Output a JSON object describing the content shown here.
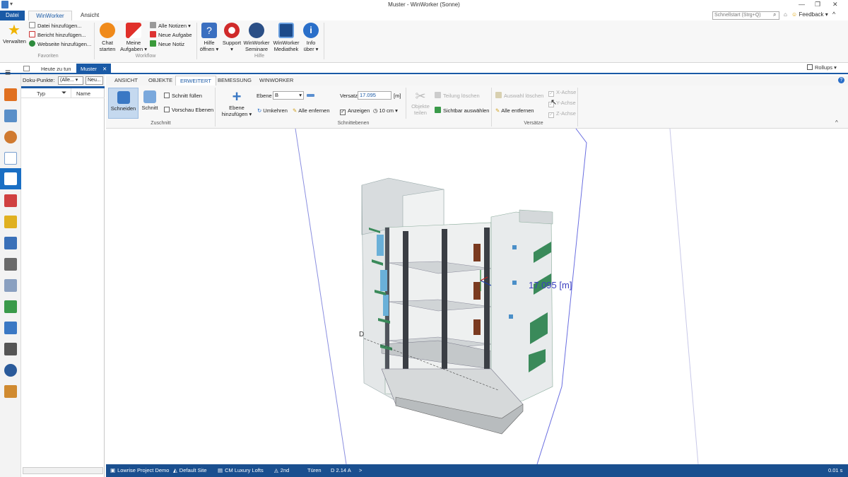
{
  "window": {
    "title": "Muster - WinWorker (Sonne)",
    "search_placeholder": "Schnellstart (Strg+Q)",
    "feedback": "Feedback",
    "minimize": "—",
    "restore": "❐",
    "close": "✕"
  },
  "ribbon_tabs": [
    "Datei",
    "WinWorker",
    "Ansicht"
  ],
  "ribbon": {
    "favoriten": {
      "verwalten": "Verwalten",
      "datei_hinzufuegen": "Datei hinzufügen...",
      "bericht_hinzufuegen": "Bericht hinzufügen...",
      "webseite_hinzufuegen": "Webseite hinzufügen...",
      "label": "Favoriten"
    },
    "workflow": {
      "chat_1": "Chat",
      "chat_2": "starten",
      "aufgaben_1": "Meine",
      "aufgaben_2": "Aufgaben",
      "alle_notizen": "Alle Notizen",
      "neue_aufgabe": "Neue Aufgabe",
      "neue_notiz": "Neue Notiz",
      "label": "Workflow"
    },
    "hilfe": {
      "hilfe_1": "Hilfe",
      "hilfe_2": "öffnen",
      "support": "Support",
      "seminare_1": "WinWorker",
      "seminare_2": "Seminare",
      "mediathek_1": "WinWorker",
      "mediathek_2": "Mediathek",
      "info_1": "Info",
      "info_2": "über",
      "label": "Hilfe"
    }
  },
  "doc_tabs": [
    "Heute zu tun",
    "Muster"
  ],
  "rollups": "Rollups",
  "doku": {
    "label": "Doku-Punkte:",
    "filter": "(Alle...",
    "new": "Neu...",
    "col_typ": "Typ",
    "col_name": "Name"
  },
  "viewer_tabs": [
    "ANSICHT",
    "OBJEKTE",
    "ERWEITERT",
    "BEMESSUNG",
    "WINWORKER"
  ],
  "viewer_ribbon": {
    "schneiden": "Schneiden",
    "schnitt": "Schnitt",
    "schnitt_fuellen": "Schnitt füllen",
    "vorschau_ebenen": "Vorschau Ebenen",
    "zuschnitt_label": "Zuschnitt",
    "ebene_hinzufuegen_1": "Ebene",
    "ebene_hinzufuegen_2": "hinzufügen",
    "ebene_label": "Ebene",
    "ebene_value": "B",
    "umkehren": "Umkehren",
    "alle_entfernen": "Alle enfernen",
    "versatz_label": "Versatz",
    "versatz_value": "17.095",
    "unit": "[m]",
    "anzeigen": "Anzeigen",
    "step": "10 cm",
    "objekte_teilen_1": "Objekte",
    "objekte_teilen_2": "teilen",
    "teilung_loeschen": "Teilung löschen",
    "sichtbar_auswaehlen": "Sichtbar auswählen",
    "schnittebenen_label": "Schnittebenen",
    "auswahl_loeschen": "Auswahl löschen",
    "alle_entfernen_2": "Alle entfernen",
    "x_achse": "X-Achse",
    "y_achse": "Y-Achse",
    "z_achse": "Z-Achse",
    "versaetze_label": "Versätze"
  },
  "canvas": {
    "dimension_label": "17.095 [m]",
    "plane_label": "D"
  },
  "status_bar": {
    "items": [
      "Lowrise Project Demo",
      "Default Site",
      "CM Luxury Lofts",
      "2nd",
      "Türen",
      "D 2.14 A"
    ],
    "more": ">",
    "timing": "0.01 s"
  },
  "colors": {
    "accent": "#1a5aa6",
    "status_bg": "#1a4f8f",
    "section_plane": "#5b5fd6"
  }
}
